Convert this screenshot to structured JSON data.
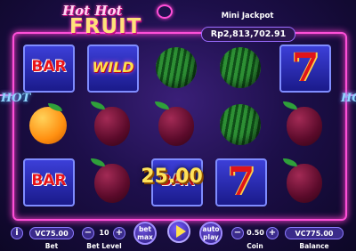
{
  "logo": {
    "line1": "Hot Hot",
    "line2": "FRUIT"
  },
  "jackpot": {
    "label": "Mini Jackpot",
    "value": "Rp2,813,702.91"
  },
  "side_text": {
    "left": "HOT",
    "right": "HOT"
  },
  "reels": [
    [
      "BAR",
      "orange",
      "BAR"
    ],
    [
      "WILD",
      "plum",
      "plum"
    ],
    [
      "watermelon",
      "plum",
      "BAR"
    ],
    [
      "watermelon",
      "watermelon",
      "7"
    ],
    [
      "7",
      "plum",
      "plum"
    ]
  ],
  "symbols": {
    "bar": "BAR",
    "wild": "WILD",
    "seven": "7"
  },
  "win_amount": "25.00",
  "controls": {
    "info_icon": "info-icon",
    "bet_value": "VC75.00",
    "bet_label": "Bet",
    "minus": "−",
    "plus": "+",
    "bet_level_value": "10",
    "bet_level_label": "Bet Level",
    "bet_max_label": "bet max",
    "spin_icon": "play-icon",
    "autoplay_label": "auto play",
    "coin_value": "0.50",
    "coin_label": "Coin",
    "balance_value": "VC775.00",
    "balance_label": "Balance"
  },
  "colors": {
    "neon_pink": "#ff4fd8",
    "gold": "#ffe14a",
    "bar_red": "#e8141a",
    "panel_blue": "#3a2b8a"
  }
}
